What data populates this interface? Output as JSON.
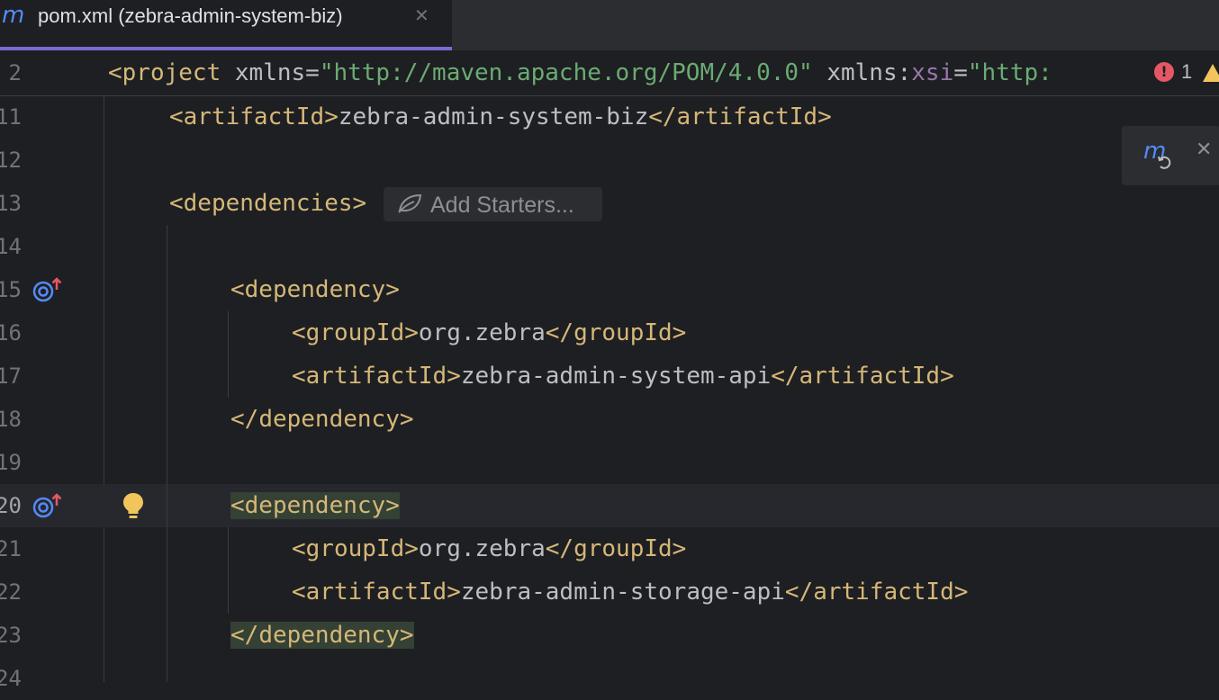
{
  "tab": {
    "icon": "maven-icon",
    "title": "pom.xml (zebra-admin-system-biz)",
    "close": "✕"
  },
  "sticky_line": {
    "number": "2",
    "open": "<",
    "tag": "project",
    "attr1": " xmlns=",
    "val1": "\"http://maven.apache.org/POM/4.0.0\"",
    "attr2_prefix": " xmlns:",
    "attr2_ns": "xsi",
    "attr2_eq": "=",
    "val2": "\"http:"
  },
  "inspections": {
    "error_icon": "!",
    "error_count": "1"
  },
  "lines": [
    {
      "number": "11",
      "open": "<",
      "tag_open": "artifactId",
      "gt": ">",
      "text": "zebra-admin-system-biz",
      "close": "</",
      "tag_close": "artifactId",
      "end": ">"
    },
    {
      "number": "12"
    },
    {
      "number": "13",
      "open": "<",
      "tag_open": "dependencies",
      "gt": ">"
    },
    {
      "number": "14"
    },
    {
      "number": "15",
      "open": "<",
      "tag_open": "dependency",
      "gt": ">"
    },
    {
      "number": "16",
      "open": "<",
      "tag_open": "groupId",
      "gt": ">",
      "text": "org.zebra",
      "close": "</",
      "tag_close": "groupId",
      "end": ">"
    },
    {
      "number": "17",
      "open": "<",
      "tag_open": "artifactId",
      "gt": ">",
      "text": "zebra-admin-system-api",
      "close": "</",
      "tag_close": "artifactId",
      "end": ">"
    },
    {
      "number": "18",
      "close": "</",
      "tag_close": "dependency",
      "end": ">"
    },
    {
      "number": "19"
    },
    {
      "number": "20",
      "open": "<",
      "tag_open": "dependency",
      "gt": ">"
    },
    {
      "number": "21",
      "open": "<",
      "tag_open": "groupId",
      "gt": ">",
      "text": "org.zebra",
      "close": "</",
      "tag_close": "groupId",
      "end": ">"
    },
    {
      "number": "22",
      "open": "<",
      "tag_open": "artifactId",
      "gt": ">",
      "text": "zebra-admin-storage-api",
      "close": "</",
      "tag_close": "artifactId",
      "end": ">"
    },
    {
      "number": "23",
      "close": "</",
      "tag_close": "dependency",
      "end": ">"
    },
    {
      "number": "24"
    }
  ],
  "inlay": {
    "icon": "spring-leaf-icon",
    "label": "Add Starters..."
  },
  "maven_popup": {
    "icon": "maven-reload-icon",
    "close": "✕"
  },
  "colors": {
    "background": "#1e1f22",
    "tag": "#d5b778",
    "string": "#6aab73",
    "namespace": "#9876aa",
    "text": "#bcbec4",
    "brace_highlight": "#344134",
    "error": "#e55765",
    "accent": "#7b6ad4"
  }
}
